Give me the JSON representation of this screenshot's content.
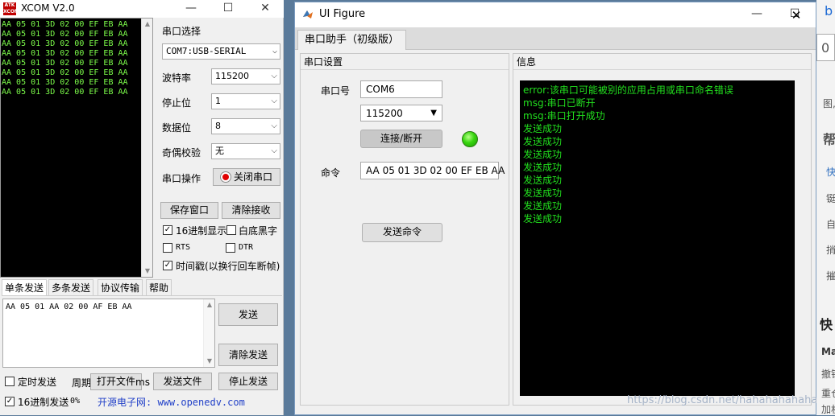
{
  "xcom": {
    "title": "XCOM V2.0",
    "logo_text": "ATK XCOM",
    "rx_lines": [
      "AA 05 01 3D 02 00 EF EB AA",
      "AA 05 01 3D 02 00 EF EB AA",
      "AA 05 01 3D 02 00 EF EB AA",
      "AA 05 01 3D 02 00 EF EB AA",
      "AA 05 01 3D 02 00 EF EB AA",
      "AA 05 01 3D 02 00 EF EB AA",
      "AA 05 01 3D 02 00 EF EB AA",
      "AA 05 01 3D 02 00 EF EB AA"
    ],
    "port_select_label": "串口选择",
    "port_value": "COM7:USB-SERIAL",
    "baud_label": "波特率",
    "baud_value": "115200",
    "stop_label": "停止位",
    "stop_value": "1",
    "data_label": "数据位",
    "data_value": "8",
    "parity_label": "奇偶校验",
    "parity_value": "无",
    "op_label": "串口操作",
    "close_port_label": "关闭串口",
    "save_window_label": "保存窗口",
    "clear_rx_label": "清除接收",
    "hex_display_label": "16进制显示",
    "white_bg_label": "白底黑字",
    "rts_label": "RTS",
    "dtr_label": "DTR",
    "timestamp_label": "时间戳(以换行回车断帧)",
    "tabs": [
      "单条发送",
      "多条发送",
      "协议传输",
      "帮助"
    ],
    "tx_text": "AA 05 01 AA 02 00 AF EB AA",
    "send_label": "发送",
    "clear_send_label": "清除发送",
    "timed_send_label": "定时发送",
    "period_label": "周期:",
    "period_unit": "ms",
    "open_file_label": "打开文件",
    "send_file_label": "发送文件",
    "stop_send_label": "停止发送",
    "hex_send_label": "16进制发送",
    "percent_label": "0%",
    "footer_text": "开源电子网: www.openedv.com"
  },
  "figure": {
    "title": "UI Figure",
    "tab_label": "串口助手（初级版）",
    "settings_panel_title": "串口设置",
    "port_label": "串口号",
    "port_value": "COM6",
    "baud_value": "115200",
    "connect_label": "连接/断开",
    "command_label": "命令",
    "command_value": "AA 05 01 3D 02 00 EF EB AA",
    "send_cmd_label": "发送命令",
    "info_panel_title": "信息",
    "info_lines": [
      "error:该串口可能被别的应用占用或串口命名错误",
      "msg:串口已断开",
      "msg:串口打开成功",
      "发送成功",
      "发送成功",
      "发送成功",
      "发送成功",
      "发送成功",
      "发送成功",
      "发送成功",
      "发送成功"
    ],
    "lamp_color": "#38d60f"
  },
  "background_app": {
    "texts": [
      "0",
      "图,",
      "帮",
      "快",
      "铤",
      "自",
      "捎",
      "摧",
      "快",
      "Ma",
      "撤销",
      "重仓",
      "加机"
    ]
  },
  "watermark": "https://blog.csdn.net/hahahahahaha"
}
